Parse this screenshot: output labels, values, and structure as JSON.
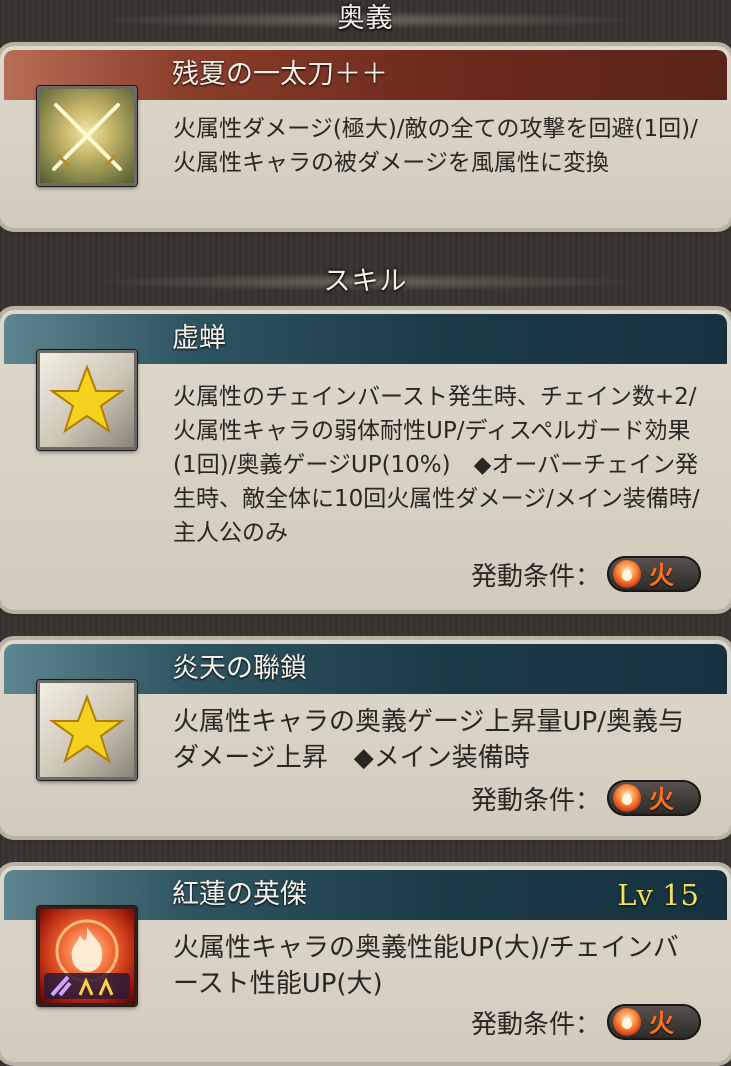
{
  "sections": {
    "ougi_header": "奥義",
    "skill_header": "スキル"
  },
  "ougi": {
    "name": "残夏の一太刀＋＋",
    "description": "火属性ダメージ(極大)/敵の全ての攻撃を回避(1回)/火属性キャラの被ダメージを風属性に変換",
    "icon": "crossed-swords-icon"
  },
  "skills": [
    {
      "name": "虚蝉",
      "description": "火属性のチェインバースト発生時、チェイン数+2/火属性キャラの弱体耐性UP/ディスペルガード効果(1回)/奥義ゲージUP(10%)　◆オーバーチェイン発生時、敵全体に10回火属性ダメージ/メイン装備時/主人公のみ",
      "condition_label": "発動条件：",
      "element": "火",
      "icon": "star-icon"
    },
    {
      "name": "炎天の聯鎖",
      "description": "火属性キャラの奥義ゲージ上昇量UP/奥義与ダメージ上昇　◆メイン装備時",
      "condition_label": "発動条件：",
      "element": "火",
      "icon": "star-icon"
    },
    {
      "name": "紅蓮の英傑",
      "level": "Lv 15",
      "description": "火属性キャラの奥義性能UP(大)/チェインバースト性能UP(大)",
      "condition_label": "発動条件：",
      "element": "火",
      "icon": "flame-emblem-icon"
    }
  ],
  "colors": {
    "ougi_title_bar": "#6f2a1c",
    "skill_title_bar": "#1b3b47",
    "level_text": "#f4e05a",
    "fire_element": "#ff6f1e"
  }
}
